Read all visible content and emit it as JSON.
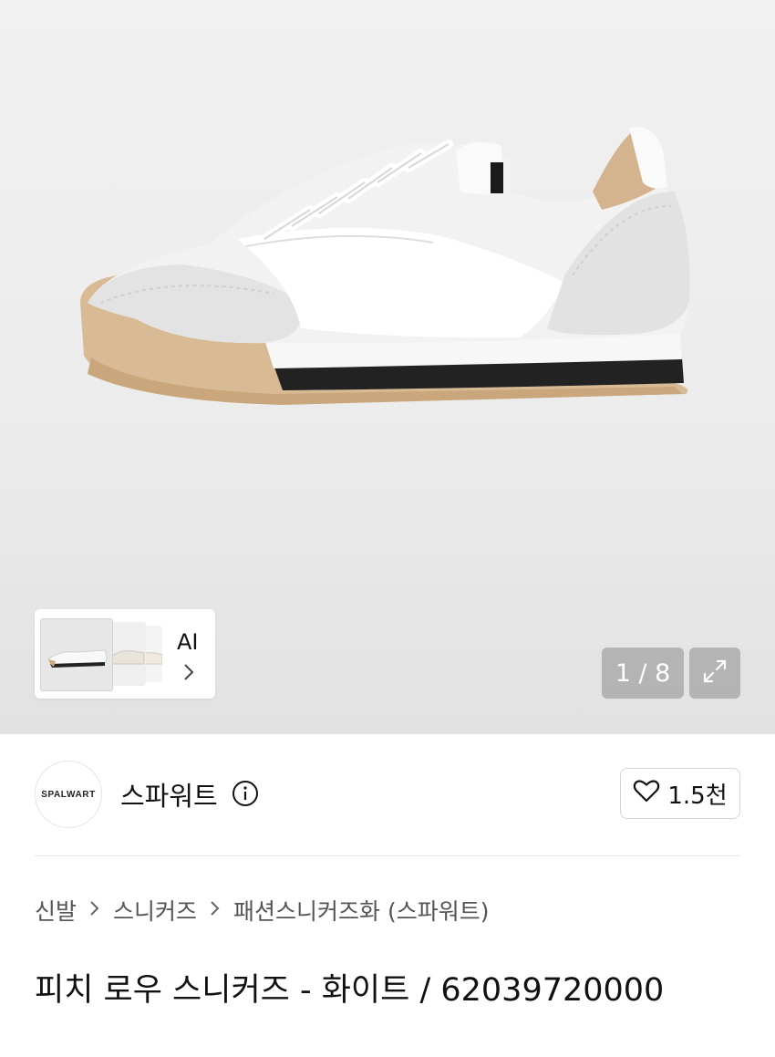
{
  "gallery": {
    "ai_label": "AI",
    "counter": "1 / 8"
  },
  "brand": {
    "logo_text": "SPALWART",
    "name": "스파워트",
    "like_count": "1.5천"
  },
  "breadcrumb": [
    "신발",
    "스니커즈",
    "패션스니커즈화 (스파워트)"
  ],
  "product": {
    "title": "피치 로우 스니커즈 - 화이트 / 62039720000"
  },
  "icons": {
    "ai_chevron": "chevron-right-icon",
    "expand": "expand-icon",
    "info": "info-icon",
    "like": "heart-outline-icon",
    "breadcrumb_separator": "chevron-right-icon"
  },
  "colors": {
    "counter_bg": "#969696",
    "border": "#d5d5d5"
  }
}
